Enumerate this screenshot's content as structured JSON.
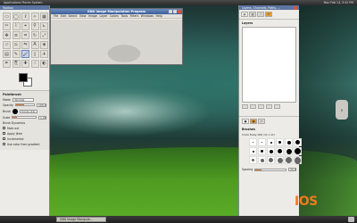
{
  "image_window": {
    "title": "GNU Image Manipulation Program",
    "menu": [
      "File",
      "Edit",
      "Select",
      "View",
      "Image",
      "Layer",
      "Colors",
      "Tools",
      "Filters",
      "Windows",
      "Help"
    ]
  },
  "toolbox": {
    "title": "Toolbox",
    "tool_icons": [
      "rect-select-icon",
      "ellipse-select-icon",
      "free-select-icon",
      "fuzzy-select-icon",
      "color-select-icon",
      "scissors-icon",
      "paths-icon",
      "color-picker-icon",
      "zoom-icon",
      "measure-icon",
      "move-icon",
      "align-icon",
      "crop-icon",
      "rotate-icon",
      "scale-icon",
      "shear-icon",
      "perspective-icon",
      "flip-icon",
      "text-icon",
      "bucket-fill-icon",
      "blend-icon",
      "pencil-icon",
      "paintbrush-icon",
      "eraser-icon",
      "airbrush-icon",
      "ink-icon",
      "clone-icon",
      "heal-icon",
      "smudge-icon",
      "dodge-burn-icon"
    ],
    "options": {
      "title": "Paintbrush",
      "mode_label": "Mode:",
      "mode_value": "Normal",
      "opacity_label": "Opacity",
      "opacity_value": "100.0",
      "brush_label": "Brush",
      "brush_value": "Circle (11)",
      "scale_label": "Scale",
      "scale_value": "1.00",
      "brush_dynamics": "Brush Dynamics",
      "fade_out": "Fade out",
      "apply_jitter": "Apply jitter",
      "incremental": "Incremental",
      "use_color": "Use color from gradient"
    }
  },
  "dock": {
    "title": "Layers, Channels, Paths, ...",
    "layers_label": "Layers",
    "brushes_label": "Brushes",
    "brush_name": "Circle Fuzzy (09) (11 x 11)",
    "spacing_label": "Spacing",
    "spacing_value": "20.0"
  },
  "top_panel": {
    "apps": "Applications  Places  System",
    "clock": "Mon Feb 14, 3:42 PM"
  },
  "taskbar": {
    "task": "GNU Image Manipula..."
  },
  "brand": {
    "logo": "IOS"
  }
}
